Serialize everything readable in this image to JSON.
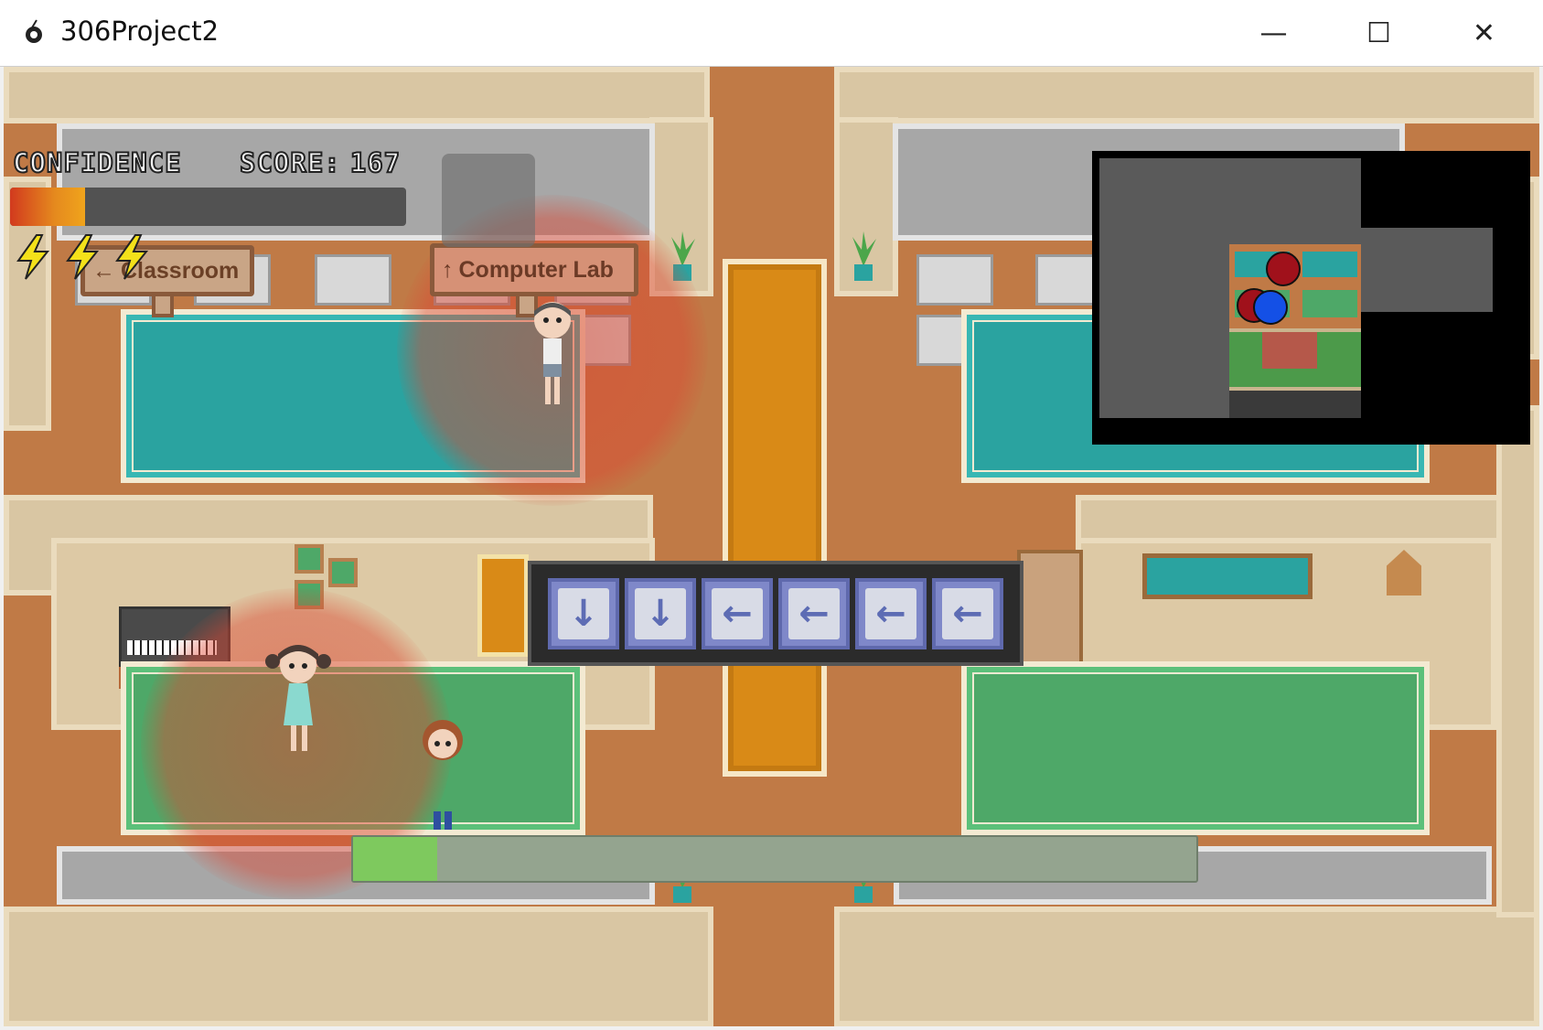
{
  "window": {
    "title": "306Project2",
    "minimize_glyph": "—",
    "maximize_glyph": "☐",
    "close_glyph": "✕"
  },
  "hud": {
    "confidence_label": "CONFIDENCE",
    "score_label": "SCORE:",
    "score_value": "167",
    "confidence_fraction": 0.19,
    "energy_bolts": 3,
    "bolt_icon": "lightning-bolt-icon"
  },
  "signs": {
    "classroom": {
      "label": "Classroom",
      "arrow": "←"
    },
    "computer_lab": {
      "label": "Computer Lab",
      "arrow": "↑"
    }
  },
  "arrow_sequence": {
    "keys": [
      "↓",
      "↓",
      "←",
      "←",
      "←",
      "←"
    ],
    "icon_names": [
      "arrow-down-icon",
      "arrow-down-icon",
      "arrow-left-icon",
      "arrow-left-icon",
      "arrow-left-icon",
      "arrow-left-icon"
    ]
  },
  "progress": {
    "fraction": 0.1
  },
  "minimap": {
    "markers": [
      {
        "type": "npc",
        "color": "#a0111b"
      },
      {
        "type": "npc",
        "color": "#a0111b"
      },
      {
        "type": "player",
        "color": "#1450e6"
      }
    ]
  },
  "colors": {
    "floor": "#bf7a45",
    "runner": "#d98a17",
    "rug_teal": "#2aa3a0",
    "rug_green": "#4ea868",
    "danger_glow": "#dc4632",
    "arrow_key": "#7f88c9",
    "progress_fill": "#7ec95e"
  }
}
